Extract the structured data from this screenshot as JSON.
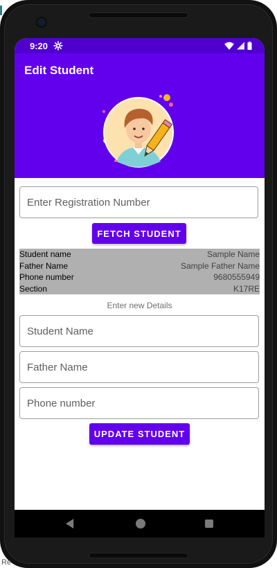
{
  "status": {
    "time": "9:20",
    "icons": [
      "gear-icon",
      "wifi-icon",
      "signal-icon",
      "battery-icon"
    ]
  },
  "appbar": {
    "title": "Edit Student",
    "bg": "#6200ee",
    "status_bg": "#4f00cf"
  },
  "fetch": {
    "reg_placeholder": "Enter Registration Number",
    "button_label": "FETCH STUDENT"
  },
  "info": {
    "rows": [
      {
        "label": "Student name",
        "value": "Sample Name"
      },
      {
        "label": "Father Name",
        "value": "Sample Father Name"
      },
      {
        "label": "Phone number",
        "value": "9680555949"
      },
      {
        "label": "Section",
        "value": "K17RE"
      }
    ],
    "bg": "#b0b0b0"
  },
  "update": {
    "hint": "Enter new Details",
    "student_name_placeholder": "Student Name",
    "father_name_placeholder": "Father Name",
    "phone_placeholder": "Phone number",
    "button_label": "UPDATE STUDENT"
  },
  "nav": {
    "back_icon": "back-icon",
    "home_icon": "home-icon",
    "recent_icon": "recent-apps-icon"
  },
  "corner_text": "Re"
}
